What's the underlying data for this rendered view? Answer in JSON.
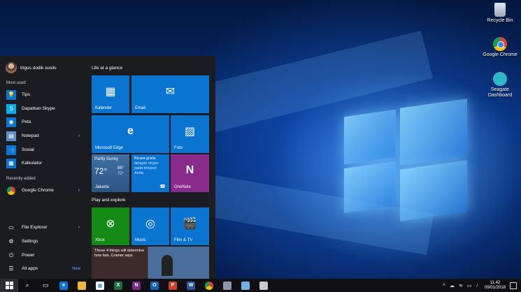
{
  "desktop": {
    "icons": [
      {
        "label": "Recycle Bin",
        "icon": "recycle-bin-icon"
      },
      {
        "label": "Google Chrome",
        "icon": "chrome-icon"
      },
      {
        "label": "Seagate Dashboard",
        "icon": "seagate-icon"
      }
    ]
  },
  "start_menu": {
    "user_name": "trigus dodik susilo",
    "most_used_label": "Most used",
    "most_used": [
      {
        "label": "Tips",
        "icon": "lightbulb-icon"
      },
      {
        "label": "Dapatkan Skype",
        "icon": "skype-icon"
      },
      {
        "label": "Peta",
        "icon": "map-icon"
      },
      {
        "label": "Notepad",
        "icon": "notepad-icon",
        "has_submenu": true
      },
      {
        "label": "Sosial",
        "icon": "people-icon"
      },
      {
        "label": "Kalkulator",
        "icon": "calculator-icon"
      }
    ],
    "recently_added_label": "Recently added",
    "recently_added": [
      {
        "label": "Google Chrome",
        "icon": "chrome-icon",
        "has_submenu": true
      }
    ],
    "system": {
      "file_explorer": "File Explorer",
      "settings": "Settings",
      "power": "Power",
      "all_apps": "All apps",
      "new_badge": "New"
    },
    "groups": {
      "life": "Life at a glance",
      "play": "Play and explore"
    },
    "tiles": {
      "kalender": "Kalender",
      "email": "Email",
      "edge": "Microsoft Edge",
      "foto": "Foto",
      "weather": {
        "condition": "Partly Sunny",
        "temp": "72°",
        "high": "86°",
        "low": "72°",
        "city": "Jakarta"
      },
      "skype": {
        "line1": "Bicara gratis",
        "line2": "dengan skype",
        "line3": "pada telepon",
        "line4": "Anda"
      },
      "onenote": "OneNote",
      "xbox": "Xbox",
      "music": "Music",
      "film": "Film & TV",
      "news_headline": "These 4 things will determine how fast, Cramer says"
    }
  },
  "taskbar": {
    "clock_time": "11.42",
    "clock_date": "09/01/2018",
    "accent": "#0a74d1"
  }
}
